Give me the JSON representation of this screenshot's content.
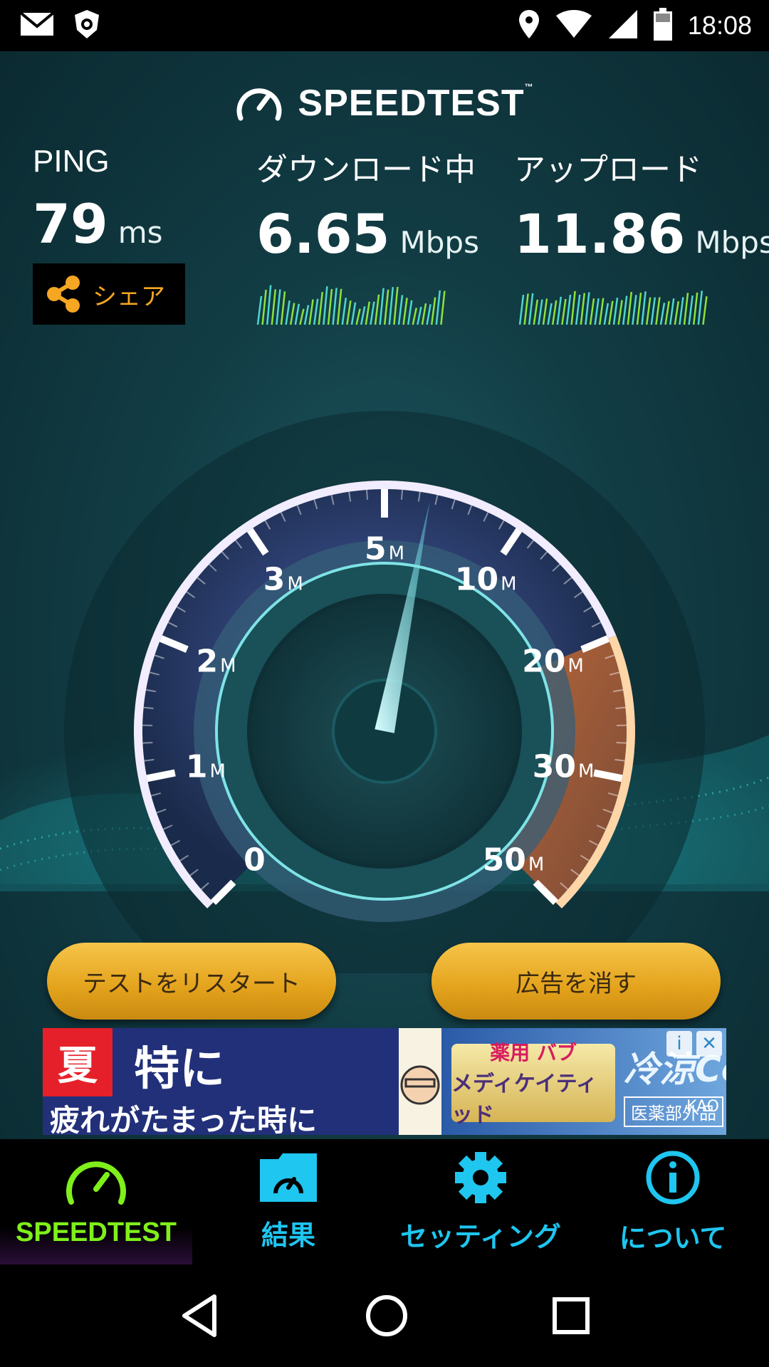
{
  "status_bar": {
    "time": "18:08",
    "left_icons": [
      "email-icon",
      "security-shield-icon"
    ],
    "right_icons": [
      "location-icon",
      "wifi-icon",
      "cell-signal-icon",
      "battery-icon"
    ]
  },
  "app": {
    "logo_text": "SPEEDTEST",
    "logo_tm": "™"
  },
  "metrics": {
    "ping": {
      "label": "PING",
      "value": "79",
      "unit": "ms"
    },
    "download": {
      "label": "ダウンロード中",
      "value": "6.65",
      "unit": "Mbps"
    },
    "upload": {
      "label": "アップロード",
      "value": "11.86",
      "unit": "Mbps"
    }
  },
  "share": {
    "label": "シェア",
    "icon": "share-icon"
  },
  "gauge": {
    "ticks": [
      {
        "value": "0",
        "unit": ""
      },
      {
        "value": "1",
        "unit": "M"
      },
      {
        "value": "2",
        "unit": "M"
      },
      {
        "value": "3",
        "unit": "M"
      },
      {
        "value": "5",
        "unit": "M"
      },
      {
        "value": "10",
        "unit": "M"
      },
      {
        "value": "20",
        "unit": "M"
      },
      {
        "value": "30",
        "unit": "M"
      },
      {
        "value": "50",
        "unit": "M"
      }
    ],
    "needle_value_mbps": 6.65
  },
  "buttons": {
    "restart": "テストをリスタート",
    "remove_ads": "広告を消す"
  },
  "ad": {
    "badge": "夏",
    "line1": "特に",
    "line2": "疲れがたまった時に",
    "product_top": "薬用 バブ",
    "product_name": "メディケイティッド",
    "cool_text": "冷涼Cool",
    "sub_text": "医薬部外品",
    "brand": "KAO",
    "choices": [
      "i",
      "✕"
    ]
  },
  "tabs": [
    {
      "label": "SPEEDTEST",
      "icon": "speedometer-icon",
      "active": true
    },
    {
      "label": "結果",
      "icon": "results-folder-icon",
      "active": false
    },
    {
      "label": "セッティング",
      "icon": "gear-icon",
      "active": false
    },
    {
      "label": "について",
      "icon": "info-icon",
      "active": false
    }
  ],
  "nav": [
    "back-icon",
    "home-icon",
    "recents-icon"
  ],
  "colors": {
    "accent_green": "#7ff01a",
    "accent_cyan": "#1ec6f0",
    "button_gold": "#e3a21b",
    "share_orange": "#f5a623",
    "gauge_purple": "#8a6fd6",
    "gauge_orange": "#f0923a"
  }
}
